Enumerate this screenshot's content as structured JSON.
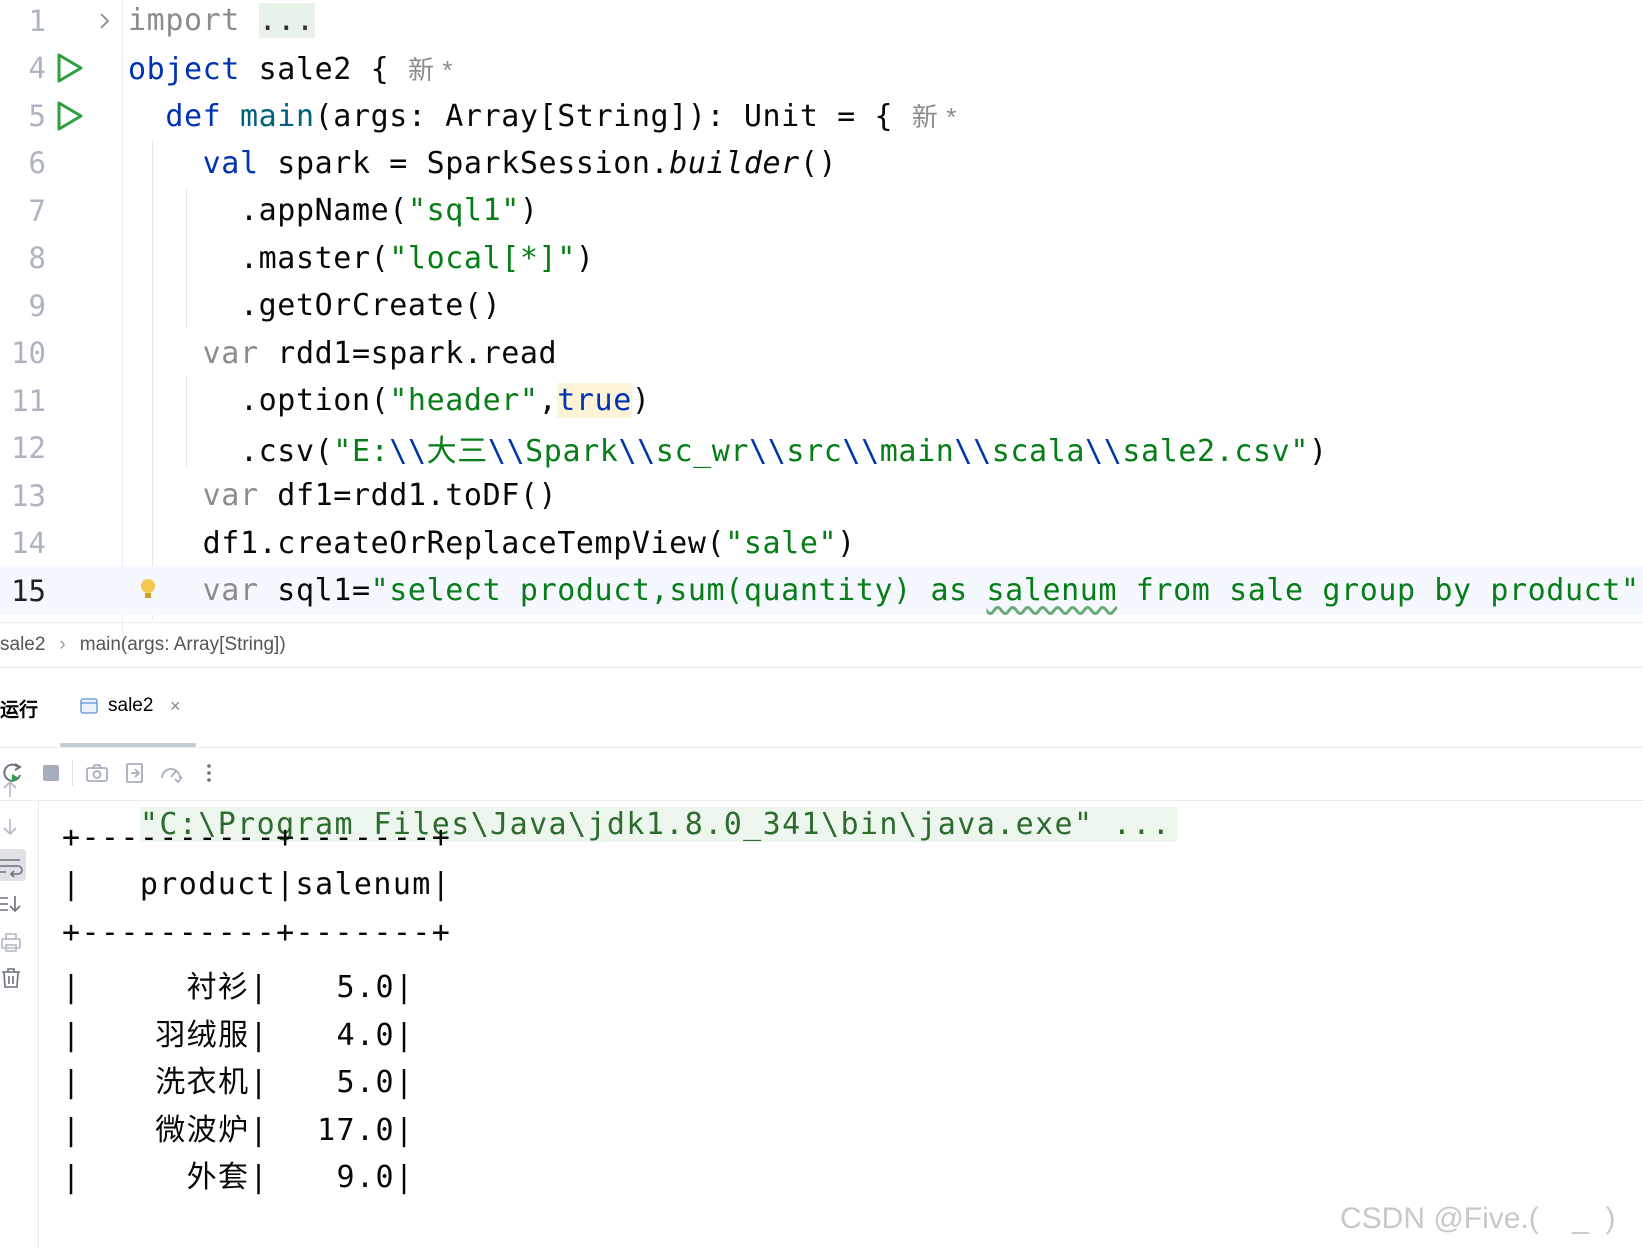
{
  "editor": {
    "lines": [
      {
        "num": "1",
        "parts": [
          {
            "t": "import ",
            "c": "gray"
          },
          {
            "t": "...",
            "c": "fold-box"
          }
        ],
        "fold": true
      },
      {
        "num": "4",
        "parts": [
          {
            "t": "object ",
            "c": "kw"
          },
          {
            "t": "sale2 { "
          },
          {
            "t": "新 *",
            "c": "inlay"
          }
        ],
        "run": true
      },
      {
        "num": "5",
        "parts": [
          {
            "t": "  def ",
            "c": "kw"
          },
          {
            "t": "main",
            "c": "fn"
          },
          {
            "t": "(args: Array[String]): Unit = { "
          },
          {
            "t": "新 *",
            "c": "inlay"
          }
        ],
        "run": true
      },
      {
        "num": "6",
        "parts": [
          {
            "t": "    val ",
            "c": "kw"
          },
          {
            "t": "spark = SparkSession."
          },
          {
            "t": "builder",
            "c": "ital"
          },
          {
            "t": "()"
          }
        ]
      },
      {
        "num": "7",
        "parts": [
          {
            "t": "      .appName("
          },
          {
            "t": "\"sql1\"",
            "c": "str"
          },
          {
            "t": ")"
          }
        ]
      },
      {
        "num": "8",
        "parts": [
          {
            "t": "      .master("
          },
          {
            "t": "\"local[*]\"",
            "c": "str"
          },
          {
            "t": ")"
          }
        ]
      },
      {
        "num": "9",
        "parts": [
          {
            "t": "      .getOrCreate()"
          }
        ]
      },
      {
        "num": "10",
        "parts": [
          {
            "t": "    var ",
            "c": "gray"
          },
          {
            "t": "rdd1=spark.read"
          }
        ]
      },
      {
        "num": "11",
        "parts": [
          {
            "t": "      .option("
          },
          {
            "t": "\"header\"",
            "c": "str"
          },
          {
            "t": ","
          },
          {
            "t": "true",
            "c": "kw hl-true"
          },
          {
            "t": ")"
          }
        ]
      },
      {
        "num": "12",
        "parts": [
          {
            "t": "      .csv("
          },
          {
            "t": "\"E:",
            "c": "str"
          },
          {
            "t": "\\\\",
            "c": "esc"
          },
          {
            "t": "大三",
            "c": "str"
          },
          {
            "t": "\\\\",
            "c": "esc"
          },
          {
            "t": "Spark",
            "c": "str"
          },
          {
            "t": "\\\\",
            "c": "esc"
          },
          {
            "t": "sc_wr",
            "c": "str"
          },
          {
            "t": "\\\\",
            "c": "esc"
          },
          {
            "t": "src",
            "c": "str"
          },
          {
            "t": "\\\\",
            "c": "esc"
          },
          {
            "t": "main",
            "c": "str"
          },
          {
            "t": "\\\\",
            "c": "esc"
          },
          {
            "t": "scala",
            "c": "str"
          },
          {
            "t": "\\\\",
            "c": "esc"
          },
          {
            "t": "sale2.csv\"",
            "c": "str"
          },
          {
            "t": ")"
          }
        ]
      },
      {
        "num": "13",
        "parts": [
          {
            "t": "    var ",
            "c": "gray"
          },
          {
            "t": "df1=rdd1.toDF()"
          }
        ]
      },
      {
        "num": "14",
        "parts": [
          {
            "t": "    df1.createOrReplaceTempView("
          },
          {
            "t": "\"sale\"",
            "c": "str"
          },
          {
            "t": ")"
          }
        ]
      },
      {
        "num": "15",
        "parts": [
          {
            "t": "    var ",
            "c": "gray"
          },
          {
            "t": "sql1="
          },
          {
            "t": "\"select product,sum(quantity) as ",
            "c": "str"
          },
          {
            "t": "salenum",
            "c": "str squiggle"
          },
          {
            "t": " from sale group by product\"",
            "c": "str"
          }
        ],
        "current": true,
        "bulb": true
      }
    ]
  },
  "breadcrumb": {
    "items": [
      "sale2",
      "main(args: Array[String])"
    ],
    "separator": "›"
  },
  "run_panel": {
    "title": "运行",
    "tab_label": "sale2",
    "tab_close": "×"
  },
  "console": {
    "command": "\"C:\\Program Files\\Java\\jdk1.8.0_341\\bin\\java.exe\" ...",
    "border": "+----------+-------+",
    "header": "|   product|salenum|",
    "rows": [
      {
        "product": "衬衫",
        "salenum": "5.0"
      },
      {
        "product": "羽绒服",
        "salenum": "4.0"
      },
      {
        "product": "洗衣机",
        "salenum": "5.0"
      },
      {
        "product": "微波炉",
        "salenum": "17.0"
      },
      {
        "product": "外套",
        "salenum": "9.0"
      }
    ]
  },
  "watermark": "CSDN @Five.(    _  )",
  "colors": {
    "keyword": "#0033b3",
    "string": "#067d17",
    "function": "#00627a",
    "run_green": "#2f9e44",
    "bulb": "#f2c94c"
  },
  "icons": {
    "run": "play-triangle",
    "fold": "chevron-right",
    "bulb": "lightbulb"
  }
}
